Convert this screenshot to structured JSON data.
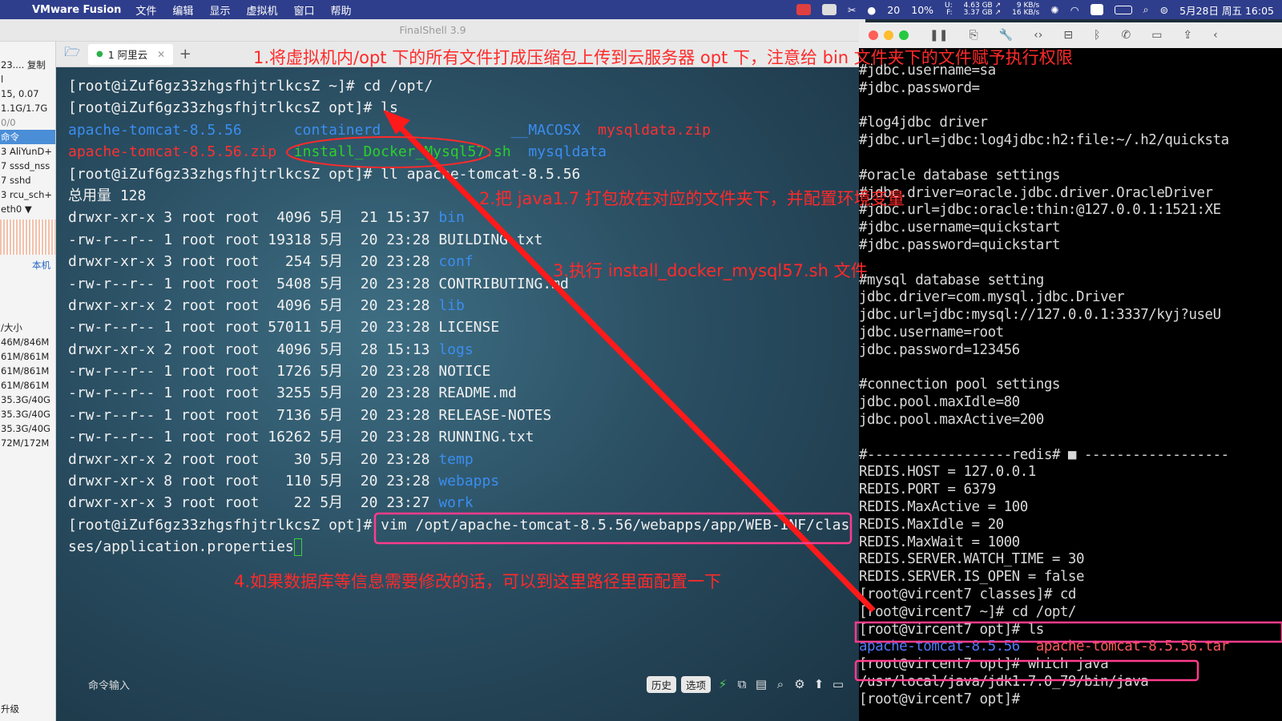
{
  "menubar": {
    "app_name": "VMware Fusion",
    "menus": [
      "文件",
      "编辑",
      "显示",
      "虚拟机",
      "窗口",
      "帮助"
    ],
    "wechat_count": "20",
    "cpu_percent": "10%",
    "mem_u": "U:",
    "mem_f": "F:",
    "mem_used": "4.63 GB ↗",
    "mem_free": "3.37 GB ↗",
    "net_up": "9 KB/s",
    "net_down": "16 KB/s",
    "datetime": "5月28日 周五 16:05"
  },
  "finalshell": {
    "title": "FinalShell 3.9",
    "tab_label": "1 阿里云",
    "tab_add": "+",
    "sidebar": {
      "rows": [
        {
          "text": "23....  复制",
          "style": ""
        },
        {
          "text": "l",
          "style": ""
        },
        {
          "text": "15, 0.07",
          "style": ""
        },
        {
          "text": "1.1G/1.7G",
          "style": ""
        },
        {
          "text": "0/0",
          "style": "gray"
        },
        {
          "text": "命令",
          "style": "hl"
        },
        {
          "text": "3 AliYunD+",
          "style": ""
        },
        {
          "text": "7 sssd_nss",
          "style": ""
        },
        {
          "text": "7 sshd",
          "style": ""
        },
        {
          "text": "3 rcu_sch+",
          "style": ""
        },
        {
          "text": "eth0 ▼",
          "style": ""
        }
      ],
      "link": "本机",
      "disk_header": "/大小",
      "disks": [
        "46M/846M",
        "61M/861M",
        "61M/861M",
        "61M/861M",
        "35.3G/40G",
        "35.3G/40G",
        "35.3G/40G",
        "72M/172M"
      ],
      "footer": "升级"
    },
    "terminal_lines": [
      [
        {
          "t": "[root@iZuf6gz33zhgsfhjtrlkcsZ ~]# cd /opt/",
          "c": ""
        }
      ],
      [
        {
          "t": "[root@iZuf6gz33zhgsfhjtrlkcsZ opt]# ls",
          "c": ""
        }
      ],
      [
        {
          "t": "apache-tomcat-8.5.56",
          "c": "c-blue"
        },
        {
          "t": "      ",
          "c": ""
        },
        {
          "t": "containerd",
          "c": "c-blue"
        },
        {
          "t": "               ",
          "c": ""
        },
        {
          "t": "__MACOSX",
          "c": "c-blue"
        },
        {
          "t": "  ",
          "c": ""
        },
        {
          "t": "mysqldata.zip",
          "c": "c-red"
        }
      ],
      [
        {
          "t": "apache-tomcat-8.5.56.zip",
          "c": "c-red"
        },
        {
          "t": "  ",
          "c": ""
        },
        {
          "t": "install_Docker_Mysql57.sh",
          "c": "c-green"
        },
        {
          "t": "  ",
          "c": ""
        },
        {
          "t": "mysqldata",
          "c": "c-blue"
        }
      ],
      [
        {
          "t": "[root@iZuf6gz33zhgsfhjtrlkcsZ opt]# ll apache-tomcat-8.5.56",
          "c": ""
        }
      ],
      [
        {
          "t": "总用量 128",
          "c": ""
        }
      ],
      [
        {
          "t": "drwxr-xr-x 3 root root  4096 5月  21 15:37 ",
          "c": ""
        },
        {
          "t": "bin",
          "c": "c-blue"
        }
      ],
      [
        {
          "t": "-rw-r--r-- 1 root root 19318 5月  20 23:28 BUILDING.txt",
          "c": ""
        }
      ],
      [
        {
          "t": "drwxr-xr-x 3 root root   254 5月  20 23:28 ",
          "c": ""
        },
        {
          "t": "conf",
          "c": "c-blue"
        }
      ],
      [
        {
          "t": "-rw-r--r-- 1 root root  5408 5月  20 23:28 CONTRIBUTING.md",
          "c": ""
        }
      ],
      [
        {
          "t": "drwxr-xr-x 2 root root  4096 5月  20 23:28 ",
          "c": ""
        },
        {
          "t": "lib",
          "c": "c-blue"
        }
      ],
      [
        {
          "t": "-rw-r--r-- 1 root root 57011 5月  20 23:28 LICENSE",
          "c": ""
        }
      ],
      [
        {
          "t": "drwxr-xr-x 2 root root  4096 5月  28 15:13 ",
          "c": ""
        },
        {
          "t": "logs",
          "c": "c-blue"
        }
      ],
      [
        {
          "t": "-rw-r--r-- 1 root root  1726 5月  20 23:28 NOTICE",
          "c": ""
        }
      ],
      [
        {
          "t": "-rw-r--r-- 1 root root  3255 5月  20 23:28 README.md",
          "c": ""
        }
      ],
      [
        {
          "t": "-rw-r--r-- 1 root root  7136 5月  20 23:28 RELEASE-NOTES",
          "c": ""
        }
      ],
      [
        {
          "t": "-rw-r--r-- 1 root root 16262 5月  20 23:28 RUNNING.txt",
          "c": ""
        }
      ],
      [
        {
          "t": "drwxr-xr-x 2 root root    30 5月  20 23:28 ",
          "c": ""
        },
        {
          "t": "temp",
          "c": "c-blue"
        }
      ],
      [
        {
          "t": "drwxr-xr-x 8 root root   110 5月  20 23:28 ",
          "c": ""
        },
        {
          "t": "webapps",
          "c": "c-blue"
        }
      ],
      [
        {
          "t": "drwxr-xr-x 3 root root    22 5月  20 23:27 ",
          "c": ""
        },
        {
          "t": "work",
          "c": "c-blue"
        }
      ],
      [
        {
          "t": "[root@iZuf6gz33zhgsfhjtrlkcsZ opt]# vim /opt/apache-tomcat-8.5.56/webapps/app/WEB-INF/clas",
          "c": ""
        }
      ],
      [
        {
          "t": "ses/application.properties",
          "c": ""
        },
        {
          "t": "__CURSOR__",
          "c": "cursor"
        }
      ]
    ],
    "cmd_input_label": "命令输入",
    "history_label": "历史",
    "options_label": "选项"
  },
  "vm_terminal": {
    "lines": [
      [
        {
          "t": "#jdbc.username=sa",
          "c": ""
        }
      ],
      [
        {
          "t": "#jdbc.password=",
          "c": ""
        }
      ],
      [
        {
          "t": "",
          "c": ""
        }
      ],
      [
        {
          "t": "#log4jdbc driver",
          "c": ""
        }
      ],
      [
        {
          "t": "#jdbc.url=jdbc:log4jdbc:h2:file:~/.h2/quicksta",
          "c": ""
        }
      ],
      [
        {
          "t": "",
          "c": ""
        }
      ],
      [
        {
          "t": "#oracle database settings",
          "c": ""
        }
      ],
      [
        {
          "t": "#jdbc.driver=oracle.jdbc.driver.OracleDriver",
          "c": ""
        }
      ],
      [
        {
          "t": "#jdbc.url=jdbc:oracle:thin:@127.0.0.1:1521:XE",
          "c": ""
        }
      ],
      [
        {
          "t": "#jdbc.username=quickstart",
          "c": ""
        }
      ],
      [
        {
          "t": "#jdbc.password=quickstart",
          "c": ""
        }
      ],
      [
        {
          "t": "",
          "c": ""
        }
      ],
      [
        {
          "t": "#mysql database setting",
          "c": ""
        }
      ],
      [
        {
          "t": "jdbc.driver=com.mysql.jdbc.Driver",
          "c": ""
        }
      ],
      [
        {
          "t": "jdbc.url=jdbc:mysql://127.0.0.1:3337/kyj?useU",
          "c": ""
        }
      ],
      [
        {
          "t": "jdbc.username=root",
          "c": ""
        }
      ],
      [
        {
          "t": "jdbc.password=123456",
          "c": ""
        }
      ],
      [
        {
          "t": "",
          "c": ""
        }
      ],
      [
        {
          "t": "#connection pool settings",
          "c": ""
        }
      ],
      [
        {
          "t": "jdbc.pool.maxIdle=80",
          "c": ""
        }
      ],
      [
        {
          "t": "jdbc.pool.maxActive=200",
          "c": ""
        }
      ],
      [
        {
          "t": "",
          "c": ""
        }
      ],
      [
        {
          "t": "#------------------redis# ■ ------------------",
          "c": ""
        }
      ],
      [
        {
          "t": "REDIS.HOST = 127.0.0.1",
          "c": ""
        }
      ],
      [
        {
          "t": "REDIS.PORT = 6379",
          "c": ""
        }
      ],
      [
        {
          "t": "REDIS.MaxActive = 100",
          "c": ""
        }
      ],
      [
        {
          "t": "REDIS.MaxIdle = 20",
          "c": ""
        }
      ],
      [
        {
          "t": "REDIS.MaxWait = 1000",
          "c": ""
        }
      ],
      [
        {
          "t": "REDIS.SERVER.WATCH_TIME = 30",
          "c": ""
        }
      ],
      [
        {
          "t": "REDIS.SERVER.IS_OPEN = false",
          "c": ""
        }
      ],
      [
        {
          "t": "[root@vircent7 classes]# cd",
          "c": ""
        }
      ],
      [
        {
          "t": "[root@vircent7 ~]# cd /opt/",
          "c": ""
        }
      ],
      [
        {
          "t": "[root@vircent7 opt]# ls",
          "c": ""
        }
      ],
      [
        {
          "t": "apache-tomcat-8.5.56",
          "c": "vm-blue"
        },
        {
          "t": "  ",
          "c": ""
        },
        {
          "t": "apache-tomcat-8.5.56.tar",
          "c": "vm-red"
        }
      ],
      [
        {
          "t": "[root@vircent7 opt]# which java",
          "c": ""
        }
      ],
      [
        {
          "t": "/usr/local/java/jdk1.7.0_79/bin/java",
          "c": ""
        }
      ],
      [
        {
          "t": "[root@vircent7 opt]#",
          "c": ""
        }
      ]
    ]
  },
  "annotations": {
    "step1": "1.将虚拟机内/opt 下的所有文件打成压缩包上传到云服务器 opt 下，注意给 bin 文件夹下的文件赋予执行权限",
    "step2": "2.把 java1.7 打包放在对应的文件夹下，并配置环境变量",
    "step3": "3.执行 install_docker_mysql57.sh 文件",
    "step4": "4.如果数据库等信息需要修改的话，可以到这里路径里面配置一下",
    "color": "#ff2a2a",
    "highlight_color": "#ff3c8c"
  }
}
